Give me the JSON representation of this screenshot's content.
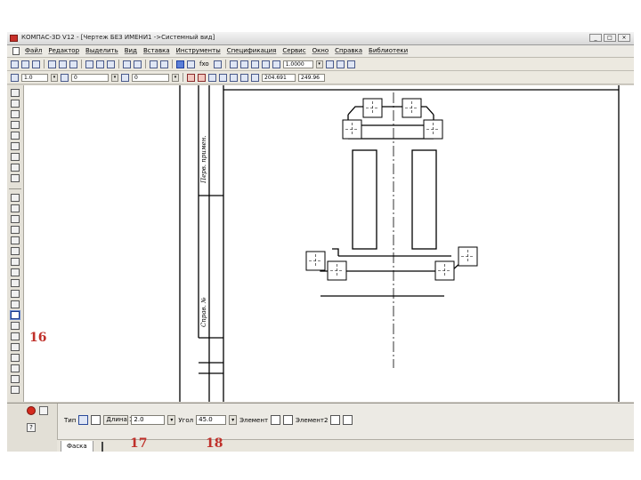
{
  "window": {
    "title": "КОМПАС-3D V12 - [Чертеж БЕЗ ИМЕНИ1 ->Системный вид]",
    "controls": [
      "_",
      "□",
      "×"
    ]
  },
  "menu": [
    "Файл",
    "Редактор",
    "Выделить",
    "Вид",
    "Вставка",
    "Инструменты",
    "Спецификация",
    "Сервис",
    "Окно",
    "Справка",
    "Библиотеки"
  ],
  "toolbar1": {
    "fx_label": "fxo",
    "zoom_value": "1.0000"
  },
  "toolbar2": {
    "scale_value": "1.0",
    "layer_value": "0",
    "style_value": "0",
    "coord_x": "204.691",
    "coord_y": "249.96"
  },
  "drawing": {
    "stamp_text_top": "Перв. примен.",
    "stamp_text_mid": "Справ. №"
  },
  "props": {
    "type_label": "Тип",
    "length_label": "Длина 1",
    "length_value": "2.0",
    "angle_label": "Угол",
    "angle_value": "45.0",
    "element_label": "Элемент",
    "element2_label": "Элемент2",
    "tab_label": "Фаска"
  },
  "callouts": {
    "c16": "16",
    "c17": "17",
    "c18": "18"
  }
}
